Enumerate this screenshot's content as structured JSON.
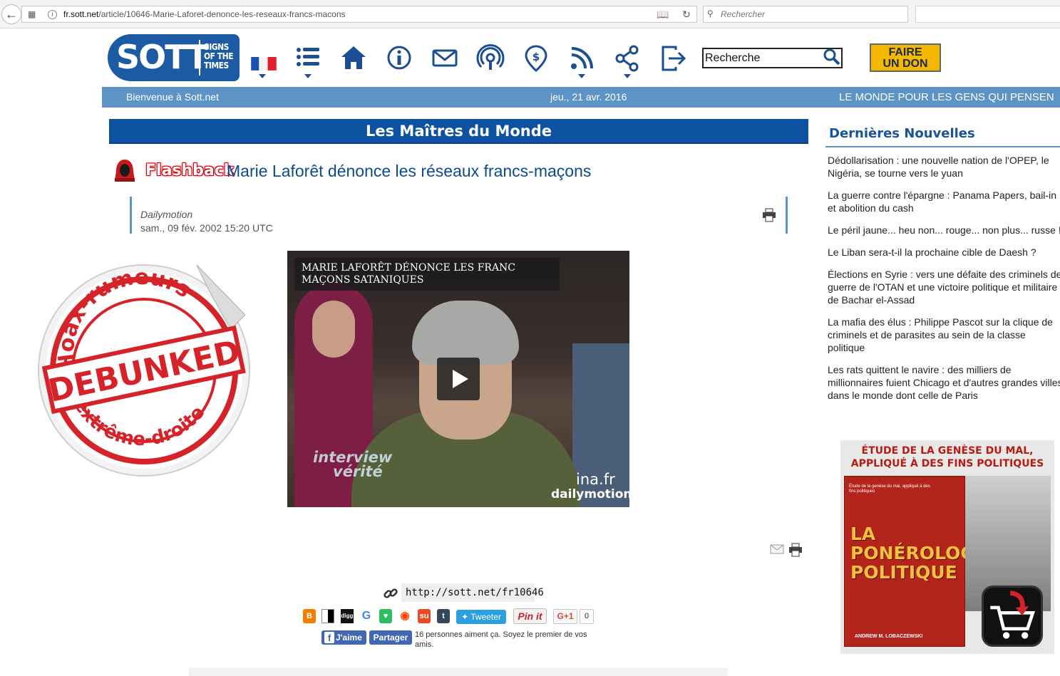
{
  "browser": {
    "url_host": "fr.sott.net",
    "url_path": "/article/10646-Marie-Laforet-denonce-les-reseaux-francs-macons",
    "search_placeholder": "Rechercher"
  },
  "header": {
    "logo_big": "SOTT",
    "logo_small_1": "SIGNS",
    "logo_small_2": "OF THE",
    "logo_small_3": "TIMES",
    "search_value": "Recherche",
    "donate_line1": "FAIRE",
    "donate_line2": "UN DON",
    "nav_icons": [
      "flag-fr-icon",
      "menu-list-icon",
      "home-icon",
      "info-icon",
      "mail-icon",
      "podcast-icon",
      "donate-dollar-pin-icon",
      "rss-icon",
      "share-icon",
      "login-icon"
    ]
  },
  "strip": {
    "welcome": "Bienvenue à Sott.net",
    "date": "jeu., 21 avr. 2016",
    "tagline": "LE MONDE POUR LES GENS QUI PENSEN"
  },
  "article": {
    "section": "Les Maîtres du Monde",
    "flashback": "Flashback",
    "title": "Marie Laforêt dénonce les réseaux francs-maçons",
    "source": "Dailymotion",
    "date": "sam., 09 fév. 2002 15:20 UTC",
    "video": {
      "caption": "MARIE LAFORÊT DÉNONCE LES FRANC MAÇONS SATANIQUES",
      "wm_interview_1": "interview",
      "wm_interview_2": "vérité",
      "wm_ina": "ina.fr",
      "wm_dailymotion": "dailymotion"
    },
    "stamp": {
      "top": "Hoax-rumeurs",
      "middle": "DEBUNKED",
      "bottom": "d'extrême-droite"
    }
  },
  "share": {
    "short_url": "http://sott.net/fr10646",
    "tweet_label": "Tweeter",
    "pinit_label": "Pin it",
    "gplus_label": "G+1",
    "gplus_count": "0",
    "fb_like": "J'aime",
    "fb_share": "Partager",
    "fb_text": "16 personnes aiment ça. Soyez le premier de vos amis.",
    "icons": [
      "blogger-icon",
      "delicious-icon",
      "digg-icon",
      "google-icon",
      "evernote-icon",
      "reddit-icon",
      "stumbleupon-icon",
      "tumblr-icon"
    ]
  },
  "sidebar": {
    "title": "Dernières Nouvelles",
    "news": [
      "Dédollarisation : une nouvelle nation de l'OPEP, le Nigéria, se tourne vers le yuan",
      "La guerre contre l'épargne : Panama Papers, bail-in et abolition du cash",
      "Le péril jaune... heu non... rouge... non plus... russe !",
      "Le Liban sera-t-il la prochaine cible de Daesh ?",
      "Élections en Syrie : vers une défaite des criminels de guerre de l'OTAN et une victoire politique et militaire de Bachar el-Assad",
      "La mafia des élus : Philippe Pascot sur la clique de criminels et de parasites au sein de la classe politique",
      "Les rats quittent le navire : des milliers de millionnaires fuient Chicago et d'autres grandes villes dans le monde dont celle de Paris"
    ],
    "ad": {
      "headline_1": "ÉTUDE DE LA GENÈSE DU MAL,",
      "headline_2": "APPLIQUÉ À DES FINS POLITIQUES",
      "cover_small": "Étude de la genèse du mal, appliqué à des fins politiques",
      "cover_title_1": "LA",
      "cover_title_2": "PONÉROLOGIE",
      "cover_title_3": "POLITIQUE",
      "cover_author": "ANDREW M. LOBACZEWSKI"
    }
  },
  "colors": {
    "brand_blue": "#1c5aa4",
    "strip_blue": "#5d93c5",
    "section_blue": "#0d52a0",
    "donate_yellow": "#f5b800",
    "flashback_red": "#e0001a"
  }
}
